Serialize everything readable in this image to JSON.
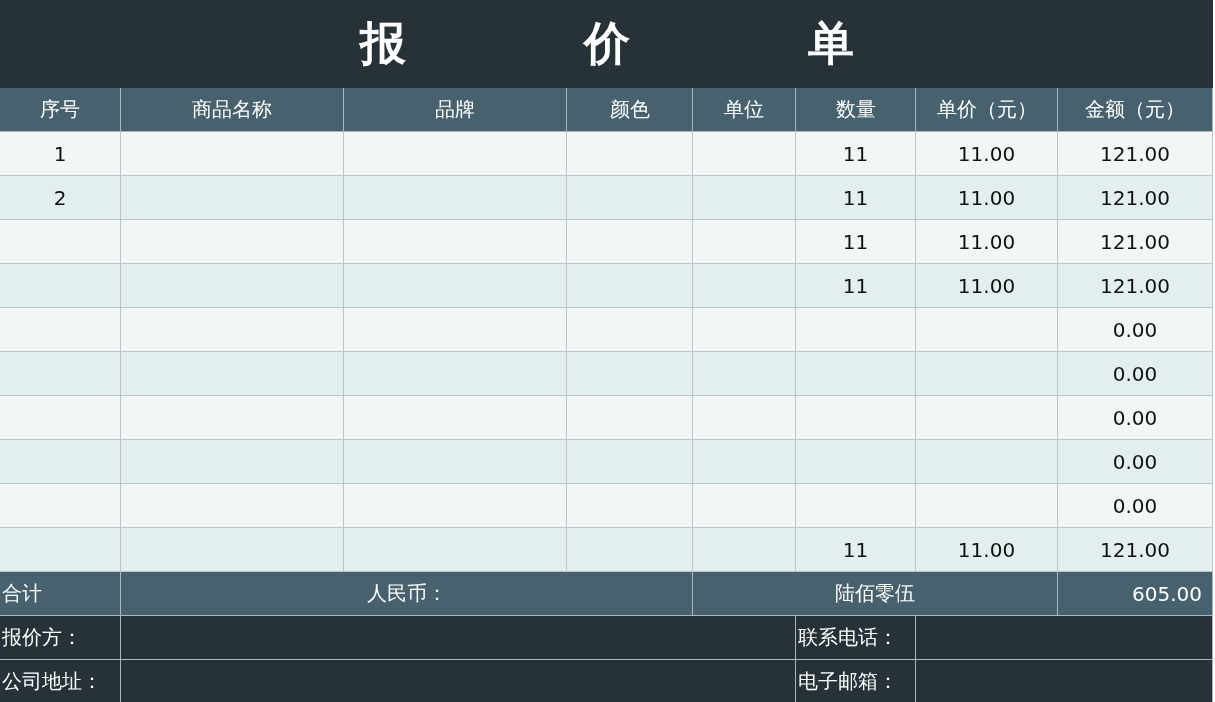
{
  "title": "报价单",
  "columns": [
    "序号",
    "商品名称",
    "品牌",
    "颜色",
    "单位",
    "数量",
    "单价（元）",
    "金额（元）"
  ],
  "rows": [
    {
      "no": "1",
      "qty": "11",
      "price": "11.00",
      "amount": "121.00"
    },
    {
      "no": "2",
      "qty": "11",
      "price": "11.00",
      "amount": "121.00"
    },
    {
      "qty": "11",
      "price": "11.00",
      "amount": "121.00"
    },
    {
      "qty": "11",
      "price": "11.00",
      "amount": "121.00"
    },
    {
      "amount": "0.00"
    },
    {
      "amount": "0.00"
    },
    {
      "amount": "0.00"
    },
    {
      "amount": "0.00"
    },
    {
      "amount": "0.00"
    },
    {
      "qty": "11",
      "price": "11.00",
      "amount": "121.00"
    }
  ],
  "total": {
    "label": "合计",
    "currency_label": "人民币：",
    "amount_in_words": "陆佰零伍",
    "amount": "605.00"
  },
  "footer": [
    {
      "label": "报价方：",
      "contact_label": "联系电话："
    },
    {
      "label": "公司地址：",
      "contact_label": "电子邮箱："
    }
  ]
}
